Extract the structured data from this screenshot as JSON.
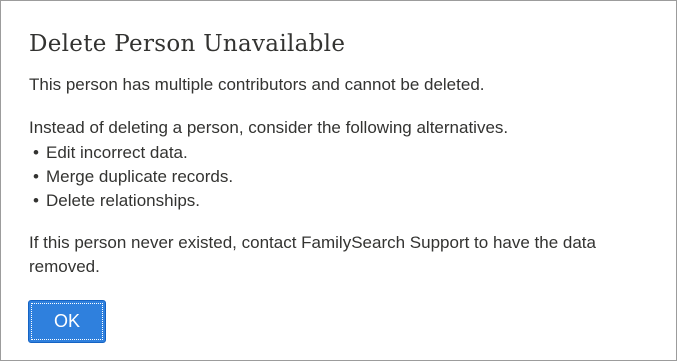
{
  "dialog": {
    "title": "Delete Person Unavailable",
    "message": "This person has multiple contributors and cannot be deleted.",
    "alternatives_intro": "Instead of deleting a person, consider the following alternatives.",
    "alternatives": [
      "Edit incorrect data.",
      "Merge duplicate records.",
      "Delete relationships."
    ],
    "support_text": "If this person never existed, contact FamilySearch Support to have the data removed.",
    "ok_label": "OK"
  },
  "colors": {
    "button_bg": "#2f80dd",
    "button_border": "#1563c4",
    "text": "#333331",
    "dialog_border": "#9c9c9c"
  }
}
